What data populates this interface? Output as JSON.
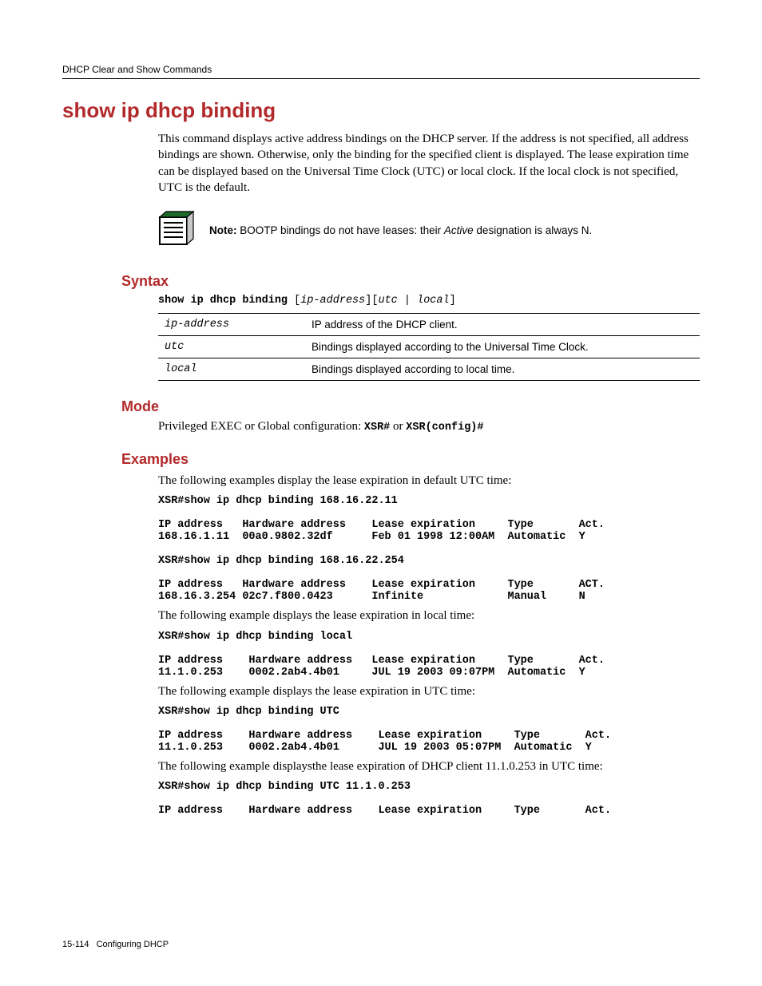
{
  "header": {
    "running": "DHCP Clear and Show Commands"
  },
  "title": "show ip dhcp binding",
  "intro": "This command displays active address bindings on the DHCP server. If the address is not specified, all address bindings are shown. Otherwise, only the binding for the specified client is displayed. The lease expiration time can be displayed based on the Universal Time Clock (UTC) or local clock. If the local clock is not specified, UTC is the default.",
  "note": {
    "label": "Note:",
    "text_before": " BOOTP bindings do not have leases: their ",
    "italic": "Active",
    "text_after": " designation is always N."
  },
  "syntax": {
    "heading": "Syntax",
    "cmd_bold": "show ip dhcp binding ",
    "cmd_rest_open1": "[",
    "cmd_ital1": "ip-address",
    "cmd_rest_mid": "][",
    "cmd_ital2": "utc",
    "cmd_pipe": " | ",
    "cmd_ital3": "local",
    "cmd_rest_close": "]",
    "params": [
      {
        "name": "ip-address",
        "desc": "IP address of the DHCP client."
      },
      {
        "name": "utc",
        "desc": "Bindings displayed according to the Universal Time Clock."
      },
      {
        "name": "local",
        "desc": "Bindings displayed according to local time."
      }
    ]
  },
  "mode": {
    "heading": "Mode",
    "text_before": "Privileged EXEC or Global configuration: ",
    "code1": "XSR#",
    "or": " or ",
    "code2": "XSR(config)#"
  },
  "examples": {
    "heading": "Examples",
    "intro1": "The following examples display the lease expiration in default UTC time:",
    "block1": "XSR#show ip dhcp binding 168.16.22.11\n\nIP address   Hardware address    Lease expiration     Type       Act.\n168.16.1.11  00a0.9802.32df      Feb 01 1998 12:00AM  Automatic  Y\n\nXSR#show ip dhcp binding 168.16.22.254\n\nIP address   Hardware address    Lease expiration     Type       ACT.\n168.16.3.254 02c7.f800.0423      Infinite             Manual     N",
    "intro2": "The following example displays the lease expiration in local time:",
    "block2": "XSR#show ip dhcp binding local\n\nIP address    Hardware address   Lease expiration     Type       Act.\n11.1.0.253    0002.2ab4.4b01     JUL 19 2003 09:07PM  Automatic  Y",
    "intro3": "The following example displays the lease expiration in UTC time:",
    "block3": "XSR#show ip dhcp binding UTC\n\nIP address    Hardware address    Lease expiration     Type       Act.\n11.1.0.253    0002.2ab4.4b01      JUL 19 2003 05:07PM  Automatic  Y",
    "intro4": "The following example displaysthe lease expiration of DHCP client 11.1.0.253 in UTC time:",
    "block4": "XSR#show ip dhcp binding UTC 11.1.0.253\n\nIP address    Hardware address    Lease expiration     Type       Act."
  },
  "footer": {
    "page": "15-114",
    "label": "Configuring DHCP"
  }
}
